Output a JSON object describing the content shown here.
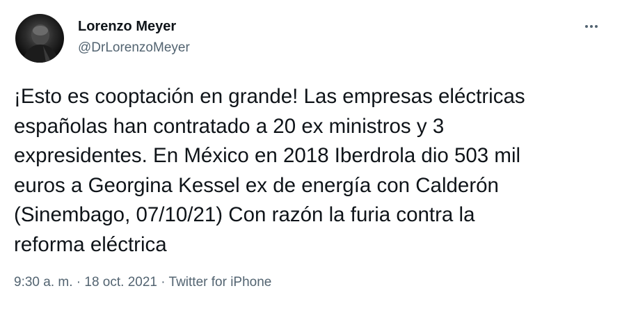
{
  "author": {
    "name": "Lorenzo Meyer",
    "handle": "@DrLorenzoMeyer",
    "avatar_icon": "profile-photo-icon"
  },
  "more_icon": "more-horizontal-icon",
  "tweet": {
    "lines": [
      "¡Esto es cooptación en grande! Las empresas eléctricas",
      "españolas han contratado a 20 ex ministros y 3",
      "expresidentes. En México en 2018 Iberdrola dio 503 mil",
      "euros a Georgina Kessel ex de energía con Calderón",
      "(Sinembago, 07/10/21) Con razón la furia contra la",
      "reforma eléctrica"
    ]
  },
  "meta": {
    "time": "9:30 a. m.",
    "separator_1": " · ",
    "date": "18 oct. 2021",
    "separator_2": " · ",
    "source": "Twitter for iPhone"
  },
  "colors": {
    "text": "#0f1419",
    "secondary": "#536471",
    "background": "#ffffff"
  }
}
